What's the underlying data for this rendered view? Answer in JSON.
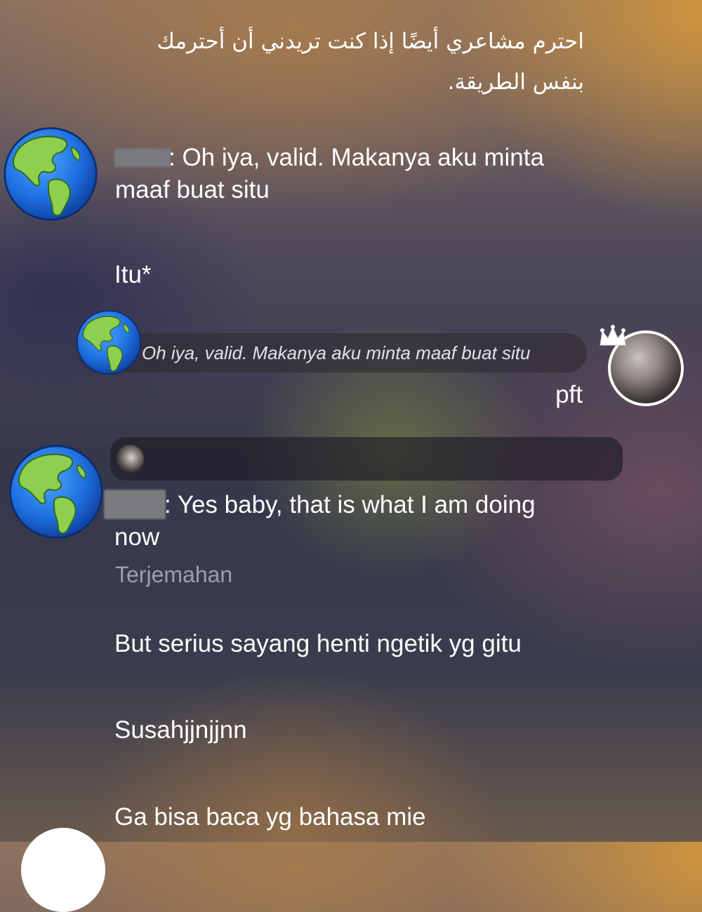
{
  "chat": {
    "top_message": "احترم مشاعري أيضًا إذا كنت تريدني أن أحترمك بنفس الطريقة.",
    "messages": [
      {
        "line1": ": Oh iya, valid. Makanya aku minta",
        "line2": "maaf buat situ"
      },
      {
        "text": "Itu*"
      }
    ],
    "reply": {
      "quoted": "Oh iya, valid. Makanya aku minta maaf buat situ",
      "text": "pft"
    },
    "second": {
      "line1": ": Yes baby, that is what I am doing",
      "line2": "now",
      "translate_label": "Terjemahan",
      "followups": [
        "But serius sayang henti ngetik yg gitu",
        "Susahjjnjjnn",
        "Ga bisa baca yg bahasa mie"
      ]
    }
  },
  "icons": {
    "partner_avatar": "globe-americas-icon",
    "user_avatar": "profile-photo",
    "crown": "crown-icon"
  },
  "colors": {
    "text": "#ffffff",
    "translate_text": "#9aa0a8",
    "quote_text": "#e2e2e6"
  }
}
